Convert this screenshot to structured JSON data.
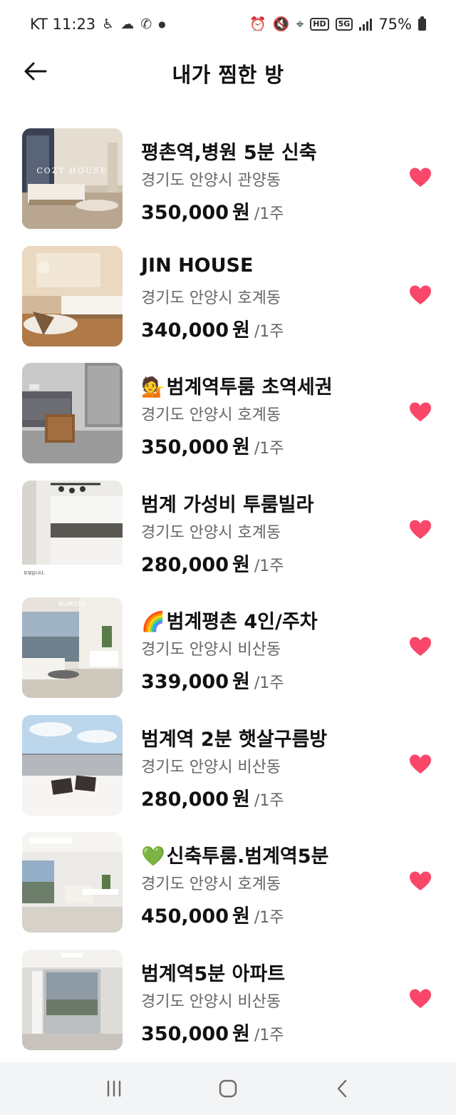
{
  "status_bar": {
    "carrier_time": "KT 11:23",
    "battery": "75%",
    "left_icons": [
      "accessibility-icon",
      "cloud-icon",
      "wifi-calling-icon",
      "dot-icon"
    ],
    "right_icons": [
      "alarm-icon",
      "mute-icon",
      "location-icon",
      "hd-icon",
      "5g-icon",
      "signal-icon",
      "battery-icon"
    ],
    "hd_label": "HD",
    "fiveg_label": "5G"
  },
  "header": {
    "title": "내가 찜한 방",
    "back_icon": "arrow-left-icon"
  },
  "colors": {
    "heart": "#f9476a",
    "text_primary": "#111111",
    "text_secondary": "#666666",
    "nav_bg": "#f3f4f6"
  },
  "listings": [
    {
      "emoji": "",
      "title": "평촌역,병원 5분 신축",
      "location": "경기도 안양시 관양동",
      "price": "350,000",
      "won": "원",
      "period": "/1주",
      "liked": true,
      "photo_text": "COZY HOUSE"
    },
    {
      "emoji": "",
      "title": "JIN HOUSE",
      "location": "경기도 안양시 호계동",
      "price": "340,000",
      "won": "원",
      "period": "/1주",
      "liked": true,
      "photo_text": ""
    },
    {
      "emoji": "💁",
      "title": "범계역투룸 초역세권",
      "location": "경기도 안양시 호계동",
      "price": "350,000",
      "won": "원",
      "period": "/1주",
      "liked": true,
      "photo_text": ""
    },
    {
      "emoji": "",
      "title": "범계 가성비 투룸빌라",
      "location": "경기도 안양시 호계동",
      "price": "280,000",
      "won": "원",
      "period": "/1주",
      "liked": true,
      "photo_text": "부엌입니다."
    },
    {
      "emoji": "🌈",
      "title": "범계평촌 4인/주차",
      "location": "경기도 안양시 비산동",
      "price": "339,000",
      "won": "원",
      "period": "/1주",
      "liked": true,
      "photo_text": "BUMGYE"
    },
    {
      "emoji": "",
      "title": "범계역 2분 햇살구름방",
      "location": "경기도 안양시 비산동",
      "price": "280,000",
      "won": "원",
      "period": "/1주",
      "liked": true,
      "photo_text": ""
    },
    {
      "emoji": "💚",
      "title": "신축투룸.범계역5분",
      "location": "경기도 안양시 호계동",
      "price": "450,000",
      "won": "원",
      "period": "/1주",
      "liked": true,
      "photo_text": ""
    },
    {
      "emoji": "",
      "title": "범계역5분 아파트",
      "location": "경기도 안양시 비산동",
      "price": "350,000",
      "won": "원",
      "period": "/1주",
      "liked": true,
      "photo_text": ""
    }
  ],
  "nav_bar": {
    "buttons": [
      "recent-apps-icon",
      "home-icon",
      "back-icon"
    ]
  }
}
